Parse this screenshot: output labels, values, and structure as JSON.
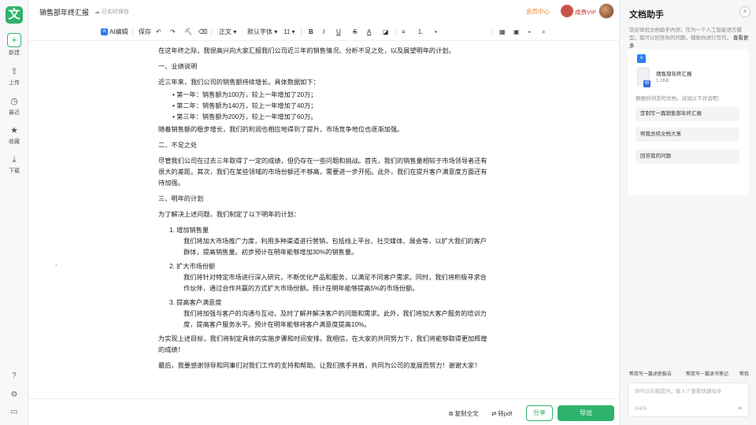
{
  "app": {
    "logo_char": "文"
  },
  "rail": {
    "new": {
      "icon": "+",
      "label": "新建"
    },
    "items": [
      {
        "icon": "⇪",
        "label": "上传"
      },
      {
        "icon": "◷",
        "label": "最近"
      },
      {
        "icon": "★",
        "label": "收藏"
      },
      {
        "icon": "⤓",
        "label": "下载"
      }
    ],
    "bottom_icons": [
      "?",
      "⚙",
      "▭"
    ]
  },
  "topbar": {
    "doc_title": "销售部年终汇报",
    "save_status": "已实时保存",
    "member_center": "会员中心",
    "vip_label": "成费VIP"
  },
  "toolbar": {
    "ai_edit": "AI编辑",
    "save": "保存",
    "undo": "↶",
    "redo": "↷",
    "format_painter": "⛏",
    "clear_format": "⌫",
    "paragraph_style": "正文",
    "font_family": "默认字体",
    "font_size": "11",
    "bold": "B",
    "italic": "I",
    "underline": "U",
    "strikethrough": "S",
    "text_color": "A",
    "highlight": "◪",
    "align": "≡",
    "ordered_list": "⒈",
    "unordered_list": "•",
    "table": "▦",
    "image": "▣",
    "link": "⌁",
    "search": "⌕",
    "dropdown": "▾"
  },
  "document": {
    "intro": "在这年终之际，我很高兴向大家汇报我们公司近三年的销售情况、分析不足之处，以及展望明年的计划。",
    "section1_title": "一、业绩说明",
    "section1_lead": "近三年来，我们公司的销售额持续增长。具体数据如下：",
    "bullets": [
      "• 第一年：销售额为100万，较上一年增加了20万；",
      "• 第二年：销售额为140万，较上一年增加了40万；",
      "• 第三年：销售额为200万，较上一年增加了60万。"
    ],
    "section1_end": "随着销售额的稳步增长，我们的利润也相应地得到了提升，市场竞争地位也逐渐加强。",
    "section2_title": "二、不足之处",
    "section2_body": "尽管我们公司在过去三年取得了一定的成绩，但仍存在一些问题和挑战。首先，我们的销售量相较于市场领导者还有很大的差距。其次，我们在某些领域的市场份额还不够高，需要进一步开拓。此外，我们在提升客户满意度方面还有待加强。",
    "section3_title": "三、明年的计划",
    "section3_lead": "为了解决上述问题，我们制定了以下明年的计划：",
    "plans": [
      {
        "title": "1. 增加销售量",
        "body": "我们将加大市场推广力度，利用多种渠道进行营销，包括线上平台、社交媒体、展会等，以扩大我们的客户群体，提高销售量。初步预计在明年能够增加30%的销售量。"
      },
      {
        "title": "2. 扩大市场份额",
        "body": "我们将针对特定市场进行深入研究，不断优化产品和服务，以满足不同客户需求。同时，我们将积极寻求合作伙伴，通过合作共赢的方式扩大市场份额。预计在明年能够提高5%的市场份额。"
      },
      {
        "title": "3. 提高客户满意度",
        "body": "我们将加强与客户的沟通与互动，及时了解并解决客户的问题和需求。此外，我们将加大客户服务的培训力度，提高客户服务水平。预计在明年能够将客户满意度提高10%。"
      }
    ],
    "closing1": "为实现上述目标，我们将制定具体的实施步骤和时间安排。我相信，在大家的共同努力下，我们将能够取得更加辉煌的成绩！",
    "closing2": "最后，我要感谢领导和同事们对我们工作的支持和帮助。让我们携手并肩，共同为公司的发展而努力！谢谢大家！"
  },
  "collapse_icon": "›",
  "bottombar": {
    "copy_all": "复制全文",
    "to_pdf": "转pdf",
    "share": "分享",
    "export": "导出"
  },
  "panel": {
    "title": "文档助手",
    "close": "×",
    "intro": "欢迎体验文档助手內测，作为一个人工智能语言模型，我可以回答你的问题，辅助你进行写作。",
    "more": "查看更多",
    "file_name": "销售部年终汇报",
    "file_size": "1.1KB",
    "file_badge": "W",
    "hint": "根据你浏览的文档，试试以下对话吧：",
    "suggestions": [
      "定制写一篇销售部年终汇报",
      "帮我总结文档大意",
      "回答我的问题"
    ],
    "quick_actions": [
      "帮我写一篇述职报告",
      "帮我写一篇读书笔记",
      "帮我"
    ],
    "input_placeholder": "你可以向我提问，输入\"/\"查看快捷指令",
    "char_count": "0/400",
    "send_icon": "➤"
  }
}
